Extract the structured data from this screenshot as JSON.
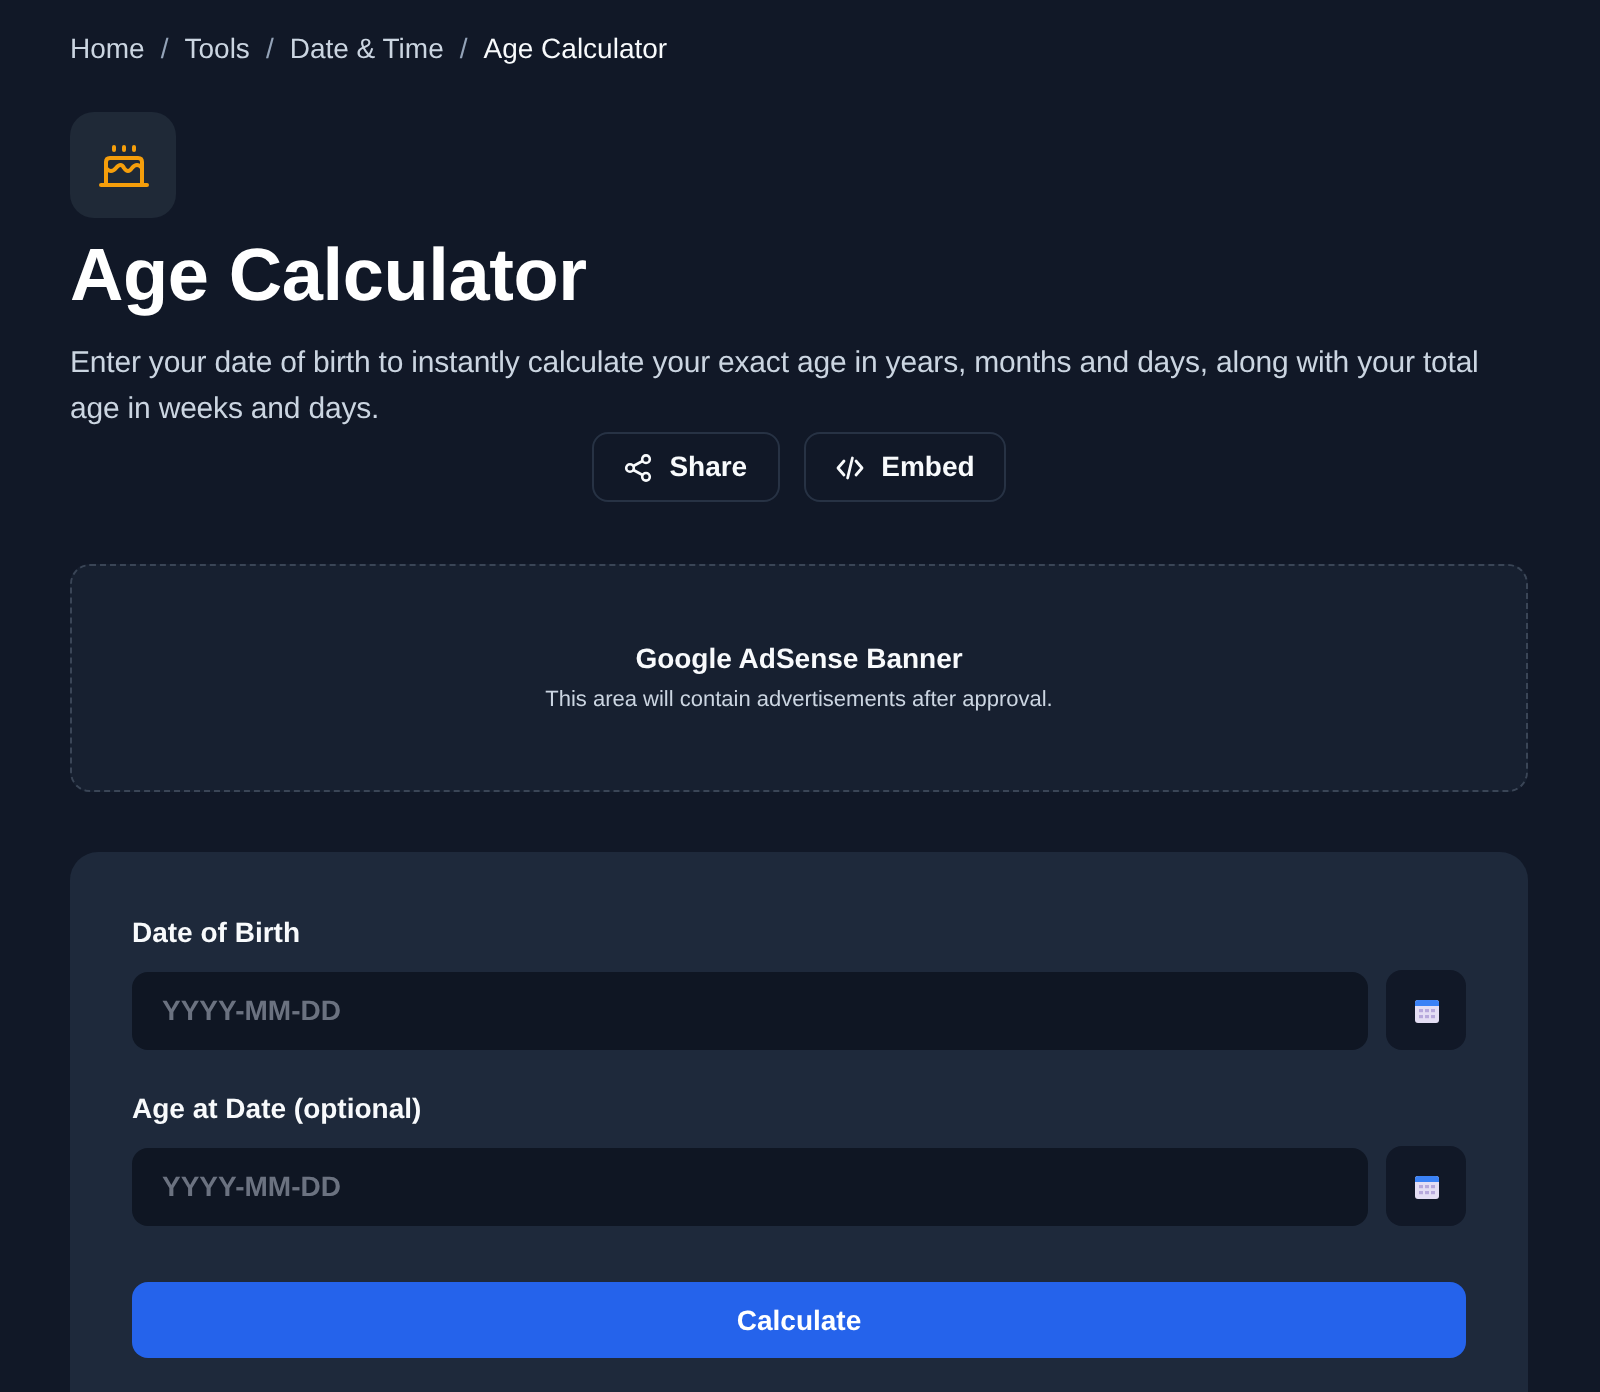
{
  "breadcrumb": {
    "items": [
      {
        "label": "Home",
        "separator": "/",
        "current": false
      },
      {
        "label": "Tools",
        "separator": "/",
        "current": false
      },
      {
        "label": "Date & Time",
        "separator": "/",
        "current": false
      },
      {
        "label": "Age Calculator",
        "current": true
      }
    ]
  },
  "header": {
    "title": "Age Calculator",
    "description": "Enter your date of birth to instantly calculate your exact age in years, months and days, along with your total age in weeks and days."
  },
  "actions": [
    {
      "label": "Share",
      "kind": "share"
    },
    {
      "label": "Embed",
      "kind": "embed"
    }
  ],
  "ad_banner": {
    "title": "Google AdSense Banner",
    "note": "This area will contain advertisements after approval."
  },
  "form": {
    "fields": [
      {
        "label": "Date of Birth",
        "placeholder": "YYYY-MM-DD"
      },
      {
        "label": "Age at Date (optional)",
        "placeholder": "YYYY-MM-DD"
      }
    ],
    "submit": "Calculate"
  }
}
